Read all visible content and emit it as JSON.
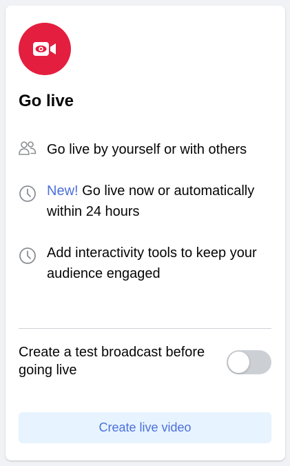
{
  "colors": {
    "accent": "#e41e3f",
    "link": "#4b70d9",
    "button_bg": "#e7f3ff",
    "toggle_off": "#ccd0d5"
  },
  "header": {
    "icon": "live-video-camera-icon",
    "title": "Go live"
  },
  "features": [
    {
      "icon": "people-icon",
      "new_label": "",
      "text": "Go live by yourself or with others"
    },
    {
      "icon": "clock-icon",
      "new_label": "New!",
      "text": " Go live now or automatically within 24 hours"
    },
    {
      "icon": "clock-icon",
      "new_label": "",
      "text": "Add interactivity tools to keep your audience engaged"
    }
  ],
  "test_broadcast": {
    "label": "Create a test broadcast before going live",
    "enabled": false
  },
  "create_button": {
    "label": "Create live video"
  }
}
